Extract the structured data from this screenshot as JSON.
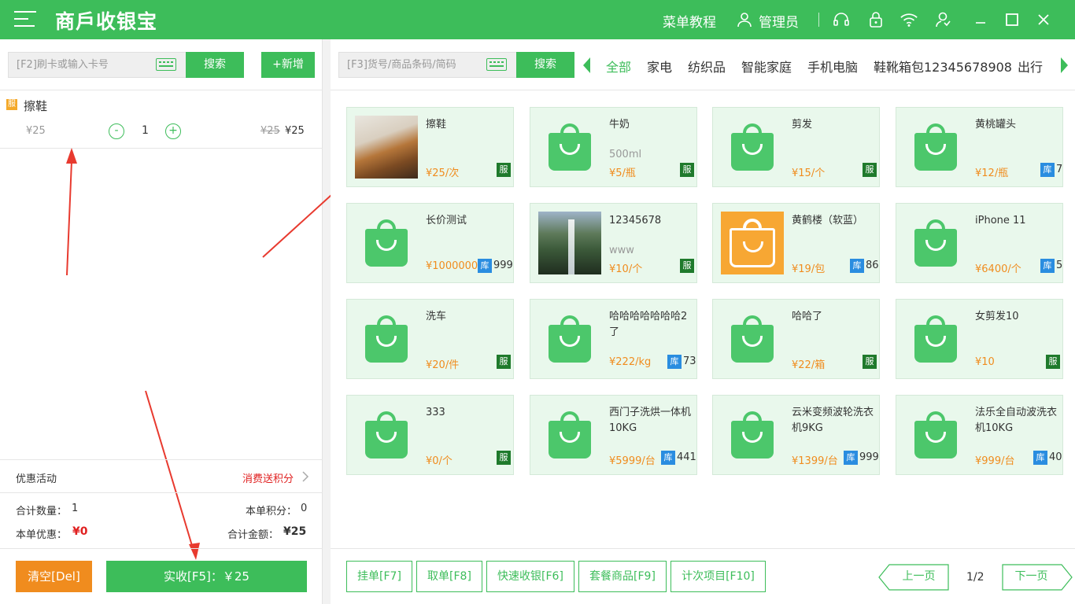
{
  "app": {
    "title": "商戶收银宝"
  },
  "header": {
    "tutorial": "菜单教程",
    "user": "管理员"
  },
  "left": {
    "card_input_placeholder": "[F2]刷卡或输入卡号",
    "search_label": "搜索",
    "add_label": "+新增",
    "cart": [
      {
        "tag": "服",
        "name": "擦鞋",
        "unit_price": "¥25",
        "qty": "1",
        "orig_price": "¥25",
        "final_price": "¥25"
      }
    ],
    "promo_label": "优惠活动",
    "promo_value": "消费送积分",
    "total_qty_label": "合计数量：",
    "total_qty": "1",
    "points_label": "本单积分：",
    "points": "0",
    "discount_label": "本单优惠：",
    "discount": "¥0",
    "total_amount_label": "合计金额：",
    "total_amount": "¥25",
    "clear_label": "清空[Del]",
    "pay_label": "实收[F5]：￥25"
  },
  "right": {
    "goods_input_placeholder": "[F3]货号/商品条码/简码",
    "search_label": "搜索",
    "tabs": [
      "全部",
      "家电",
      "纺织品",
      "智能家庭",
      "手机电脑",
      "鞋靴箱包12345678908",
      "出行"
    ],
    "products": [
      {
        "name": "擦鞋",
        "sub": "",
        "price": "¥25/次",
        "badge": "服",
        "stock": ""
      },
      {
        "name": "牛奶",
        "sub": "500ml",
        "price": "¥5/瓶",
        "badge": "服",
        "stock": ""
      },
      {
        "name": "剪发",
        "sub": "",
        "price": "¥15/个",
        "badge": "服",
        "stock": ""
      },
      {
        "name": "黄桃罐头",
        "sub": "",
        "price": "¥12/瓶",
        "badge": "库",
        "stock": "7"
      },
      {
        "name": "长价测试",
        "sub": "",
        "price": "¥1000000/",
        "badge": "库",
        "stock": "999"
      },
      {
        "name": "12345678",
        "sub": "www",
        "price": "¥10/个",
        "badge": "服",
        "stock": ""
      },
      {
        "name": "黄鹤楼（软蓝）",
        "sub": "",
        "price": "¥19/包",
        "badge": "库",
        "stock": "86"
      },
      {
        "name": "iPhone 11",
        "sub": "",
        "price": "¥6400/个",
        "badge": "库",
        "stock": "5"
      },
      {
        "name": "洗车",
        "sub": "",
        "price": "¥20/件",
        "badge": "服",
        "stock": ""
      },
      {
        "name": "哈哈哈哈哈哈哈2了",
        "sub": "",
        "price": "¥222/kg",
        "badge": "库",
        "stock": "73"
      },
      {
        "name": "哈哈了",
        "sub": "",
        "price": "¥22/箱",
        "badge": "服",
        "stock": ""
      },
      {
        "name": "女剪发10",
        "sub": "",
        "price": "¥10",
        "badge": "服",
        "stock": ""
      },
      {
        "name": "333",
        "sub": "",
        "price": "¥0/个",
        "badge": "服",
        "stock": ""
      },
      {
        "name": "西门子洗烘一体机10KG",
        "sub": "",
        "price": "¥5999/台",
        "badge": "库",
        "stock": "441"
      },
      {
        "name": "云米变频波轮洗衣机9KG",
        "sub": "",
        "price": "¥1399/台",
        "badge": "库",
        "stock": "999"
      },
      {
        "name": "法乐全自动波洗衣机10KG",
        "sub": "",
        "price": "¥999/台",
        "badge": "库",
        "stock": "40"
      }
    ],
    "actions": [
      "挂单[F7]",
      "取单[F8]",
      "快速收银[F6]",
      "套餐商品[F9]",
      "计次项目[F10]"
    ],
    "prev_label": "上一页",
    "page": "1/2",
    "next_label": "下一页"
  },
  "colors": {
    "brand": "#3dbd5a",
    "accent": "#f08c1e",
    "danger": "#e02020"
  }
}
